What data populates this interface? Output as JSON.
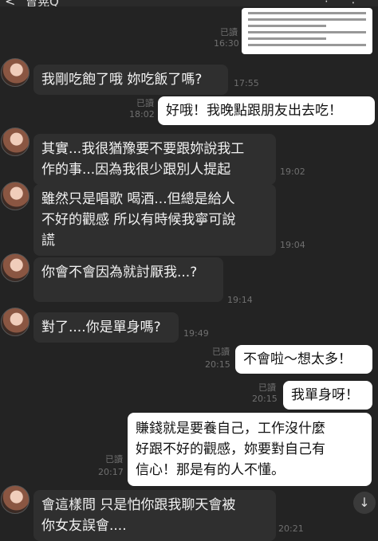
{
  "header": {
    "back": "<",
    "contact_name": "曾晃Q",
    "icons": "⁝ ⋮"
  },
  "image_message": {
    "read": "已讀",
    "time": "16:30"
  },
  "messages": [
    {
      "text": "我剛吃飽了哦 妳吃飯了嗎?",
      "time": "17:55"
    },
    {
      "text": "好哦！我晚點跟朋友出去吃！",
      "read": "已讀",
      "time": "18:02"
    },
    {
      "text": "其實...我很猶豫要不要跟妳說我工\n作的事...因為我很少跟別人提起",
      "time": "19:02"
    },
    {
      "text": "雖然只是唱歌 喝酒...但總是給人\n不好的觀感 所以有時候我寧可說\n謊",
      "time": "19:04"
    },
    {
      "text": "你會不會因為就討厭我...?",
      "time": "19:14"
    },
    {
      "text": "對了....你是單身嗎?",
      "time": "19:49"
    },
    {
      "text": "不會啦～想太多！",
      "read": "已讀",
      "time": "20:15"
    },
    {
      "text": "我單身呀！",
      "read": "已讀",
      "time": "20:15"
    },
    {
      "text": "賺錢就是要養自己，工作沒什麼\n好跟不好的觀感，妳要對自己有\n信心！那是有的人不懂。",
      "read": "已讀",
      "time": "20:17"
    },
    {
      "text": "會這樣問 只是怕你跟我聊天會被\n你女友誤會....",
      "time": "20:21"
    }
  ],
  "scroll_down_icon": "↓"
}
